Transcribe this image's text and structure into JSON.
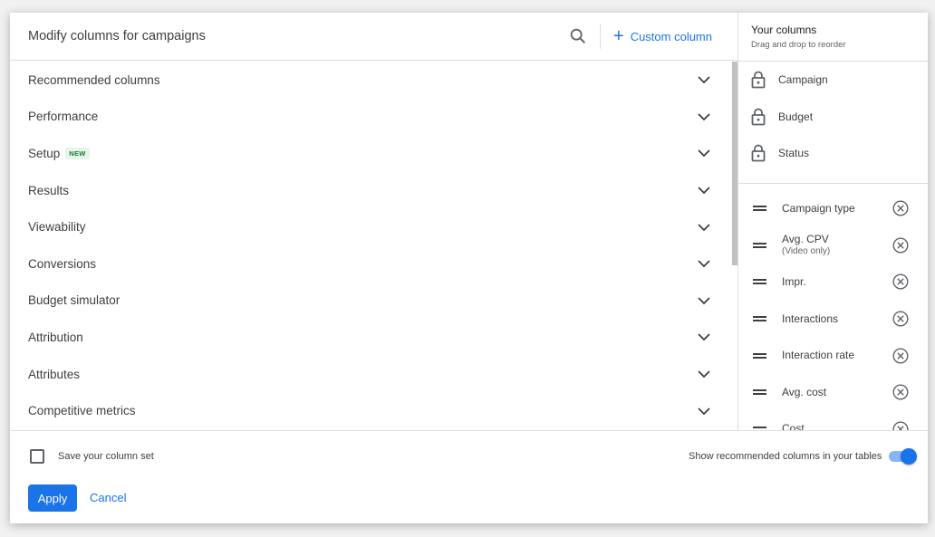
{
  "dialog": {
    "title": "Modify columns for campaigns",
    "search_icon": "search-icon",
    "custom_column_label": "Custom column",
    "custom_column_icon": "plus-icon"
  },
  "categories": [
    {
      "label": "Recommended columns",
      "badge": null
    },
    {
      "label": "Performance",
      "badge": null
    },
    {
      "label": "Setup",
      "badge": "NEW"
    },
    {
      "label": "Results",
      "badge": null
    },
    {
      "label": "Viewability",
      "badge": null
    },
    {
      "label": "Conversions",
      "badge": null
    },
    {
      "label": "Budget simulator",
      "badge": null
    },
    {
      "label": "Attribution",
      "badge": null
    },
    {
      "label": "Attributes",
      "badge": null
    },
    {
      "label": "Competitive metrics",
      "badge": null
    }
  ],
  "your_columns": {
    "title": "Your columns",
    "subtitle": "Drag and drop to reorder",
    "locked": [
      {
        "label": "Campaign",
        "icon": "lock-icon"
      },
      {
        "label": "Budget",
        "icon": "lock-icon"
      },
      {
        "label": "Status",
        "icon": "lock-icon"
      }
    ],
    "columns": [
      {
        "label": "Campaign type",
        "sub": null
      },
      {
        "label": "Avg. CPV",
        "sub": "(Video only)"
      },
      {
        "label": "Impr.",
        "sub": null
      },
      {
        "label": "Interactions",
        "sub": null
      },
      {
        "label": "Interaction rate",
        "sub": null
      },
      {
        "label": "Avg. cost",
        "sub": null
      },
      {
        "label": "Cost",
        "sub": null
      }
    ]
  },
  "footer": {
    "save_set_label": "Save your column set",
    "save_set_checked": false,
    "toggle_label": "Show recommended columns in your tables",
    "toggle_on": true,
    "apply_label": "Apply",
    "cancel_label": "Cancel"
  },
  "colors": {
    "accent": "#1a73e8",
    "badge_bg": "#e6f4ea",
    "badge_text": "#188038"
  }
}
